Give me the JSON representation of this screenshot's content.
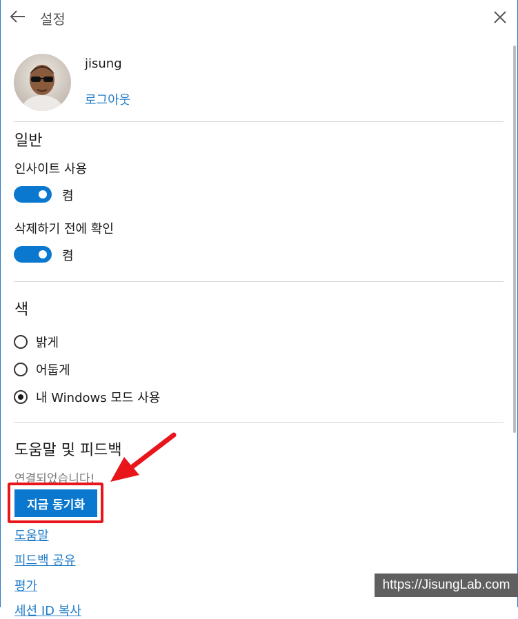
{
  "header": {
    "title": "설정",
    "back_icon": "back-arrow-icon",
    "close_icon": "close-icon"
  },
  "account": {
    "username": "jisung",
    "logout_label": "로그아웃"
  },
  "general": {
    "title": "일반",
    "insights_label": "인사이트 사용",
    "insights_state": "켬",
    "confirm_delete_label": "삭제하기 전에 확인",
    "confirm_delete_state": "켬"
  },
  "color": {
    "title": "색",
    "options": [
      {
        "label": "밝게",
        "selected": false
      },
      {
        "label": "어둡게",
        "selected": false
      },
      {
        "label": "내 Windows 모드 사용",
        "selected": true
      }
    ]
  },
  "help": {
    "title": "도움말 및 피드백",
    "status": "연결되었습니다!",
    "sync_button": "지금 동기화",
    "links": [
      "도움말",
      "피드백 공유",
      "평가",
      "세션 ID 복사"
    ]
  },
  "watermark": "https://JisungLab.com",
  "colors": {
    "accent": "#0b78cf",
    "link": "#1f7cc9",
    "annotation_red": "#e8151b"
  }
}
